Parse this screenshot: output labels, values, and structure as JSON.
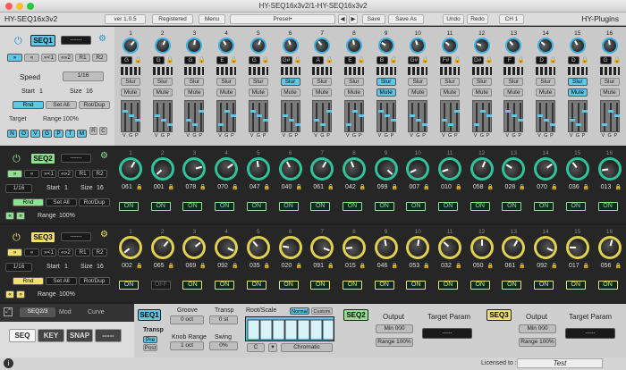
{
  "window": {
    "title": "HY-SEQ16x3v2/1-HY-SEQ16x3v2"
  },
  "header": {
    "plugin_name": "HY-SEQ16x3v2",
    "version": "ver 1.0.5",
    "registered": "Registered",
    "menu": "Menu",
    "preset": "Preset•",
    "save": "Save",
    "save_as": "Save As",
    "undo": "Undo",
    "redo": "Redo",
    "channel": "CH 1",
    "brand": "HY-Plugins"
  },
  "seq1": {
    "label": "SEQ1",
    "dropdown": "------",
    "buttons": [
      "»",
      "«",
      "»<1",
      "«»2",
      "R1",
      "R2"
    ],
    "speed_label": "Speed",
    "speed_value": "1/16",
    "start_label": "Start",
    "start_value": "1",
    "size_label": "Size",
    "size_value": "16",
    "tabs": [
      "Rnd",
      "Set All",
      "Rot/Dup"
    ],
    "target_label": "Target",
    "range_label": "Range",
    "range_value": "100%",
    "target_keys": [
      "N",
      "O",
      "V",
      "G",
      "P",
      "T",
      "M"
    ],
    "rc": [
      "R",
      "C"
    ],
    "notes": [
      "G",
      "G",
      "G",
      "E",
      "G",
      "G#",
      "A",
      "E",
      "B",
      "G#",
      "F#",
      "D#",
      "F",
      "D",
      "D",
      "G"
    ],
    "slur": "Slur",
    "mute": "Mute",
    "vgp": [
      "V",
      "G",
      "P"
    ],
    "slur_on": [
      5,
      8,
      14
    ],
    "mute_on": [
      8,
      14
    ],
    "steps": [
      1,
      2,
      3,
      4,
      5,
      6,
      7,
      8,
      9,
      10,
      11,
      12,
      13,
      14,
      15,
      16
    ],
    "knob_rot": [
      40,
      25,
      10,
      -30,
      20,
      -20,
      -40,
      -10,
      -60,
      -20,
      -50,
      -70,
      -40,
      -50,
      -30,
      -10
    ]
  },
  "seq2": {
    "label": "SEQ2",
    "dropdown": "------",
    "buttons": [
      "»",
      "«",
      "»<1",
      "«»2",
      "R1",
      "R2"
    ],
    "speed_value": "1/16",
    "start_label": "Start",
    "start_value": "1",
    "size_label": "Size",
    "size_value": "16",
    "tabs": [
      "Rnd",
      "Set All",
      "Rot/Dup"
    ],
    "range_label": "Range",
    "range_value": "100%",
    "small_buttons": [
      "«",
      "»"
    ],
    "values": [
      "061",
      "001",
      "078",
      "070",
      "047",
      "040",
      "061",
      "042",
      "099",
      "007",
      "010",
      "058",
      "028",
      "070",
      "036",
      "013"
    ],
    "on_states": [
      "ON",
      "ON",
      "ON",
      "ON",
      "ON",
      "ON",
      "ON",
      "ON",
      "ON",
      "ON",
      "ON",
      "ON",
      "ON",
      "ON",
      "ON",
      "ON"
    ]
  },
  "seq3": {
    "label": "SEQ3",
    "dropdown": "------",
    "buttons": [
      "»",
      "«",
      "»<1",
      "«»2",
      "R1",
      "R2"
    ],
    "speed_value": "1/16",
    "start_label": "Start",
    "start_value": "1",
    "size_label": "Size",
    "size_value": "16",
    "tabs": [
      "Rnd",
      "Set All",
      "Rot/Dup"
    ],
    "range_label": "Range",
    "range_value": "100%",
    "small_buttons": [
      "«",
      "»"
    ],
    "values": [
      "002",
      "065",
      "069",
      "092",
      "035",
      "020",
      "091",
      "015",
      "046",
      "053",
      "032",
      "050",
      "061",
      "092",
      "017",
      "056"
    ],
    "on_states": [
      "ON",
      "OFF",
      "ON",
      "ON",
      "ON",
      "ON",
      "ON",
      "ON",
      "ON",
      "ON",
      "ON",
      "ON",
      "ON",
      "ON",
      "ON",
      "ON"
    ]
  },
  "bottom": {
    "tabs": [
      "SEQ2/3",
      "Mod",
      "Curve"
    ],
    "seq1_label": "SEQ1",
    "groove_label": "Groove",
    "groove_value": "0 oct",
    "transp_label": "Transp",
    "transp_value": "0 st",
    "root_label": "Root/Scale",
    "normal": "Normal",
    "custom": "Custom",
    "root_value": "C",
    "scale_value": "Chromatic",
    "transp2_label": "Transp",
    "pre": "Pre",
    "post": "Post",
    "knob_range_label": "Knob Range",
    "knob_range_value": "1 oct",
    "swing_label": "Swing",
    "swing_value": "0%",
    "seq2_label": "SEQ2",
    "output_label": "Output",
    "output_min": "Min 000",
    "output_range": "Range 100%",
    "target_param_label": "Target Param",
    "target_param_value": "-----",
    "seq3_label": "SEQ3",
    "output3_min": "Min 000",
    "output3_range": "Range 100%",
    "target3_value": "-----"
  },
  "footer": {
    "tabs": [
      "SEQ",
      "KEY",
      "SNAP",
      "-----"
    ],
    "licensed": "Licensed to :",
    "licensee": "Test"
  },
  "colors": {
    "accent_blue": "#5ec8e8",
    "accent_green": "#8fe08f",
    "accent_yellow": "#f0e070"
  }
}
